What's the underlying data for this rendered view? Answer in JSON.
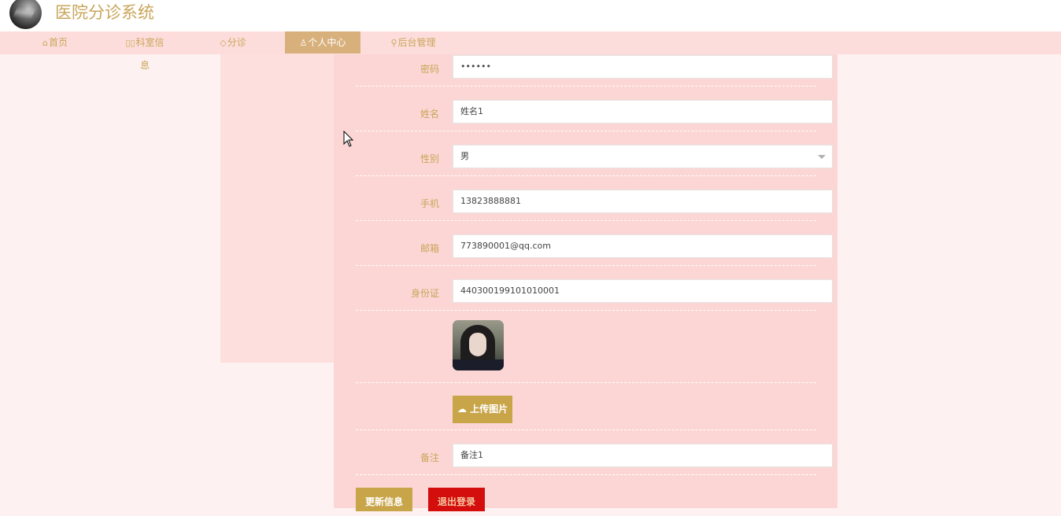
{
  "app": {
    "title": "医院分诊系统"
  },
  "nav": {
    "items": [
      {
        "icon": "home-icon",
        "label": "首页"
      },
      {
        "icon": "columns-icon",
        "label": "科室信息"
      },
      {
        "icon": "tag-icon",
        "label": "分诊"
      },
      {
        "icon": "user-icon",
        "label": "个人中心",
        "active": true
      },
      {
        "icon": "link-icon",
        "label": "后台管理"
      }
    ]
  },
  "form": {
    "password": {
      "label": "密码",
      "value": "••••••"
    },
    "name": {
      "label": "姓名",
      "value": "姓名1"
    },
    "gender": {
      "label": "性别",
      "value": "男"
    },
    "phone": {
      "label": "手机",
      "value": "13823888881"
    },
    "email": {
      "label": "邮箱",
      "value": "773890001@qq.com"
    },
    "idcard": {
      "label": "身份证",
      "value": "440300199101010001"
    },
    "upload_label": "上传图片",
    "remark": {
      "label": "备注",
      "value": "备注1"
    }
  },
  "actions": {
    "update_label": "更新信息",
    "logout_label": "退出登录"
  },
  "colors": {
    "accent": "#c9a54a",
    "nav_bg": "#fddddb",
    "panel_bg": "#fcd6d4",
    "danger": "#d40d0d"
  }
}
